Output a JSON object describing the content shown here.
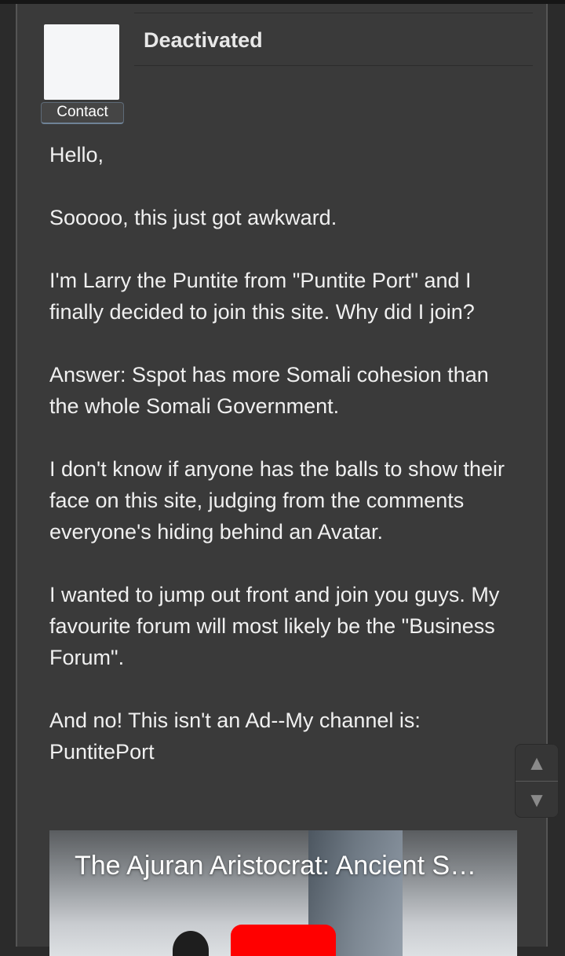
{
  "post": {
    "username": "Deactivated",
    "contact_label": "Contact",
    "paragraphs": [
      "Hello,",
      "Sooooo, this just got awkward.",
      "I'm Larry the Puntite from \"Puntite Port\" and I finally decided to join this site. Why did I join?",
      "Answer: Sspot has more Somali cohesion than the whole Somali Government.",
      "I don't know if anyone has the balls to show their face on this site, judging from the comments everyone's hiding behind an Avatar.",
      "I wanted to jump out front and join you guys. My favourite forum will most likely be the \"Business Forum\".",
      "And no! This isn't an Ad--My channel is: PuntitePort"
    ]
  },
  "video": {
    "title": "The Ajuran Aristocrat: Ancient S…"
  },
  "scroll": {
    "up_icon": "▲",
    "down_icon": "▼"
  }
}
